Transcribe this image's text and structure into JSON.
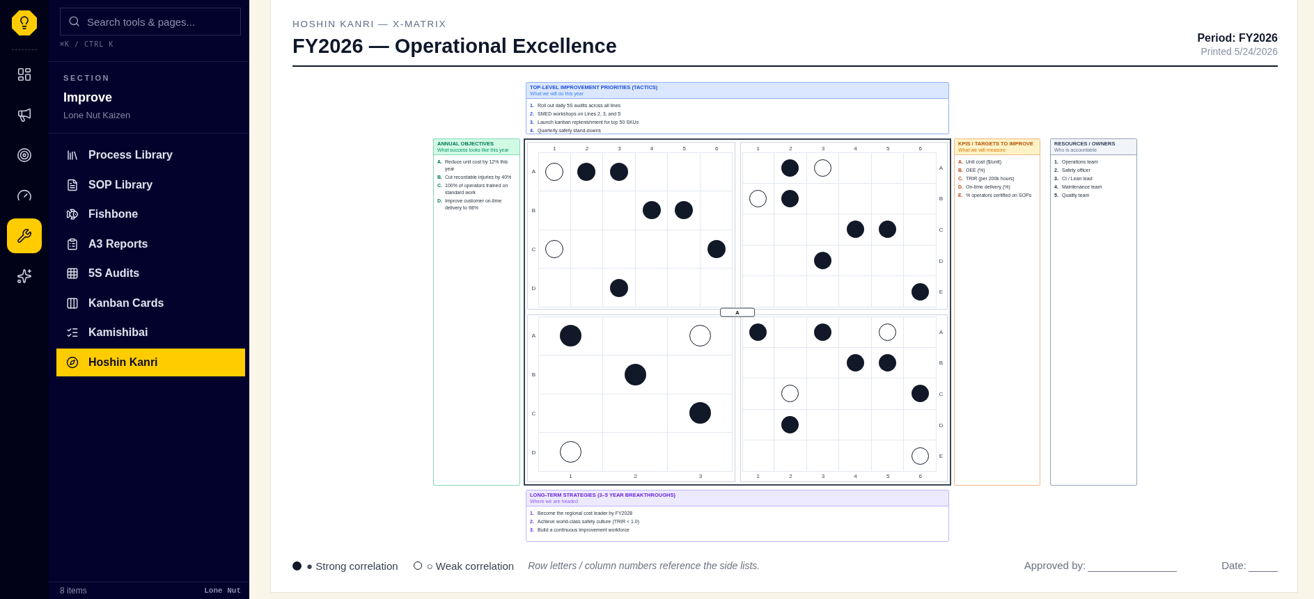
{
  "rail": {
    "items": [
      {
        "selected": false
      },
      {
        "selected": false
      },
      {
        "selected": false
      },
      {
        "selected": false
      },
      {
        "selected": true
      },
      {
        "selected": false
      }
    ]
  },
  "sidebar": {
    "search": {
      "placeholder": "Search tools & pages..."
    },
    "shortcut": "⌘K / CTRL K",
    "section": {
      "label": "SECTION",
      "title": "Improve",
      "subtitle": "Lone Nut Kaizen"
    },
    "items": [
      {
        "label": "Process Library",
        "selected": false
      },
      {
        "label": "SOP Library",
        "selected": false
      },
      {
        "label": "Fishbone",
        "selected": false
      },
      {
        "label": "A3 Reports",
        "selected": false
      },
      {
        "label": "5S Audits",
        "selected": false
      },
      {
        "label": "Kanban Cards",
        "selected": false
      },
      {
        "label": "Kamishibai",
        "selected": false
      },
      {
        "label": "Hoshin Kanri",
        "selected": true
      }
    ],
    "footer": {
      "count": "8 items",
      "brand": "Lone Nut"
    }
  },
  "header": {
    "eyebrow": "HOSHIN KANRI — X-MATRIX",
    "title": "FY2026 — Operational Excellence",
    "period": "Period: FY2026",
    "printed": "Printed 5/24/2026"
  },
  "matrix": {
    "tactics": {
      "title": "TOP-LEVEL IMPROVEMENT PRIORITIES (TACTICS)",
      "subtitle": "What we will do this year",
      "items": [
        {
          "marker": "1.",
          "text": "Roll out daily 5S audits across all lines"
        },
        {
          "marker": "2.",
          "text": "SMED workshops on Lines 2, 3, and 5"
        },
        {
          "marker": "3.",
          "text": "Launch kanban replenishment for top 50 SKUs"
        },
        {
          "marker": "4.",
          "text": "Quarterly safety stand-downs"
        }
      ]
    },
    "objectives": {
      "title": "ANNUAL OBJECTIVES",
      "subtitle": "What success looks like this year",
      "items": [
        {
          "marker": "A.",
          "text": "Reduce unit cost by 12% this year"
        },
        {
          "marker": "B.",
          "text": "Cut recordable injuries by 40%"
        },
        {
          "marker": "C.",
          "text": "100% of operators trained on standard work"
        },
        {
          "marker": "D.",
          "text": "Improve customer on-time delivery to 98%"
        }
      ]
    },
    "center_label": "A",
    "quadrants": {
      "top_left": {
        "columns": [
          "1",
          "2",
          "3",
          "4",
          "5",
          "6"
        ],
        "rows": [
          {
            "label": "A",
            "cells": [
              {
                "kind": "weak"
              },
              {
                "kind": "strong"
              },
              {
                "kind": "strong"
              },
              {
                "kind": "empty"
              },
              {
                "kind": "empty"
              },
              {
                "kind": "empty"
              }
            ]
          },
          {
            "label": "B",
            "cells": [
              {
                "kind": "empty"
              },
              {
                "kind": "empty"
              },
              {
                "kind": "empty"
              },
              {
                "kind": "strong"
              },
              {
                "kind": "strong"
              },
              {
                "kind": "empty"
              }
            ]
          },
          {
            "label": "C",
            "cells": [
              {
                "kind": "weak"
              },
              {
                "kind": "empty"
              },
              {
                "kind": "empty"
              },
              {
                "kind": "empty"
              },
              {
                "kind": "empty"
              },
              {
                "kind": "strong"
              }
            ]
          },
          {
            "label": "D",
            "cells": [
              {
                "kind": "empty"
              },
              {
                "kind": "empty"
              },
              {
                "kind": "strong"
              },
              {
                "kind": "empty"
              },
              {
                "kind": "empty"
              },
              {
                "kind": "empty"
              }
            ]
          }
        ]
      },
      "top_right": {
        "columns": [
          "1",
          "2",
          "3",
          "4",
          "5",
          "6"
        ],
        "rows": [
          {
            "label": "A",
            "cells": [
              {
                "kind": "empty"
              },
              {
                "kind": "strong"
              },
              {
                "kind": "weak"
              },
              {
                "kind": "empty"
              },
              {
                "kind": "empty"
              },
              {
                "kind": "empty"
              }
            ]
          },
          {
            "label": "B",
            "cells": [
              {
                "kind": "weak"
              },
              {
                "kind": "strong"
              },
              {
                "kind": "empty"
              },
              {
                "kind": "empty"
              },
              {
                "kind": "empty"
              },
              {
                "kind": "empty"
              }
            ]
          },
          {
            "label": "C",
            "cells": [
              {
                "kind": "empty"
              },
              {
                "kind": "empty"
              },
              {
                "kind": "empty"
              },
              {
                "kind": "strong"
              },
              {
                "kind": "strong"
              },
              {
                "kind": "empty"
              }
            ]
          },
          {
            "label": "D",
            "cells": [
              {
                "kind": "empty"
              },
              {
                "kind": "empty"
              },
              {
                "kind": "strong"
              },
              {
                "kind": "empty"
              },
              {
                "kind": "empty"
              },
              {
                "kind": "empty"
              }
            ]
          },
          {
            "label": "E",
            "cells": [
              {
                "kind": "empty"
              },
              {
                "kind": "empty"
              },
              {
                "kind": "empty"
              },
              {
                "kind": "empty"
              },
              {
                "kind": "empty"
              },
              {
                "kind": "strong"
              }
            ]
          }
        ]
      },
      "bottom_left": {
        "columns": [
          "1",
          "2",
          "3"
        ],
        "rows": [
          {
            "label": "A",
            "cells": [
              {
                "kind": "strong"
              },
              {
                "kind": "empty"
              },
              {
                "kind": "weak"
              }
            ]
          },
          {
            "label": "B",
            "cells": [
              {
                "kind": "empty"
              },
              {
                "kind": "strong"
              },
              {
                "kind": "empty"
              }
            ]
          },
          {
            "label": "C",
            "cells": [
              {
                "kind": "empty"
              },
              {
                "kind": "empty"
              },
              {
                "kind": "strong"
              }
            ]
          },
          {
            "label": "D",
            "cells": [
              {
                "kind": "weak"
              },
              {
                "kind": "empty"
              },
              {
                "kind": "empty"
              }
            ]
          }
        ]
      },
      "bottom_right": {
        "columns": [
          "1",
          "2",
          "3",
          "4",
          "5",
          "6"
        ],
        "rows": [
          {
            "label": "A",
            "cells": [
              {
                "kind": "strong"
              },
              {
                "kind": "empty"
              },
              {
                "kind": "strong"
              },
              {
                "kind": "empty"
              },
              {
                "kind": "weak"
              },
              {
                "kind": "empty"
              }
            ]
          },
          {
            "label": "B",
            "cells": [
              {
                "kind": "empty"
              },
              {
                "kind": "empty"
              },
              {
                "kind": "empty"
              },
              {
                "kind": "strong"
              },
              {
                "kind": "strong"
              },
              {
                "kind": "empty"
              }
            ]
          },
          {
            "label": "C",
            "cells": [
              {
                "kind": "empty"
              },
              {
                "kind": "weak"
              },
              {
                "kind": "empty"
              },
              {
                "kind": "empty"
              },
              {
                "kind": "empty"
              },
              {
                "kind": "strong"
              }
            ]
          },
          {
            "label": "D",
            "cells": [
              {
                "kind": "empty"
              },
              {
                "kind": "strong"
              },
              {
                "kind": "empty"
              },
              {
                "kind": "empty"
              },
              {
                "kind": "empty"
              },
              {
                "kind": "empty"
              }
            ]
          },
          {
            "label": "E",
            "cells": [
              {
                "kind": "empty"
              },
              {
                "kind": "empty"
              },
              {
                "kind": "empty"
              },
              {
                "kind": "empty"
              },
              {
                "kind": "empty"
              },
              {
                "kind": "weak"
              }
            ]
          }
        ]
      }
    },
    "kpis": {
      "title": "KPIS / TARGETS TO IMPROVE",
      "subtitle": "What we will measure",
      "items": [
        {
          "marker": "A.",
          "text": "Unit cost ($/unit)"
        },
        {
          "marker": "B.",
          "text": "OEE (%)"
        },
        {
          "marker": "C.",
          "text": "TRIR (per 200k hours)"
        },
        {
          "marker": "D.",
          "text": "On-time delivery (%)"
        },
        {
          "marker": "E.",
          "text": "% operators certified on SOPs"
        }
      ]
    },
    "resources": {
      "title": "RESOURCES / OWNERS",
      "subtitle": "Who is accountable",
      "items": [
        {
          "marker": "1.",
          "text": "Operations team"
        },
        {
          "marker": "2.",
          "text": "Safety officer"
        },
        {
          "marker": "3.",
          "text": "CI / Lean lead"
        },
        {
          "marker": "4.",
          "text": "Maintenance team"
        },
        {
          "marker": "5.",
          "text": "Quality team"
        }
      ]
    },
    "strategies": {
      "title": "LONG-TERM STRATEGIES (3–5 YEAR BREAKTHROUGHS)",
      "subtitle": "Where we are headed",
      "items": [
        {
          "marker": "1.",
          "text": "Become the regional cost leader by FY2028"
        },
        {
          "marker": "2.",
          "text": "Achieve world-class safety culture (TRIR < 1.0)"
        },
        {
          "marker": "3.",
          "text": "Build a continuous improvement workforce"
        }
      ]
    }
  },
  "legend": {
    "strong": "● Strong correlation",
    "weak": "○ Weak correlation",
    "note": "Row letters / column numbers reference the side lists."
  },
  "signoff": [
    {
      "label": "Approved by:"
    },
    {
      "label": "Date:"
    }
  ]
}
